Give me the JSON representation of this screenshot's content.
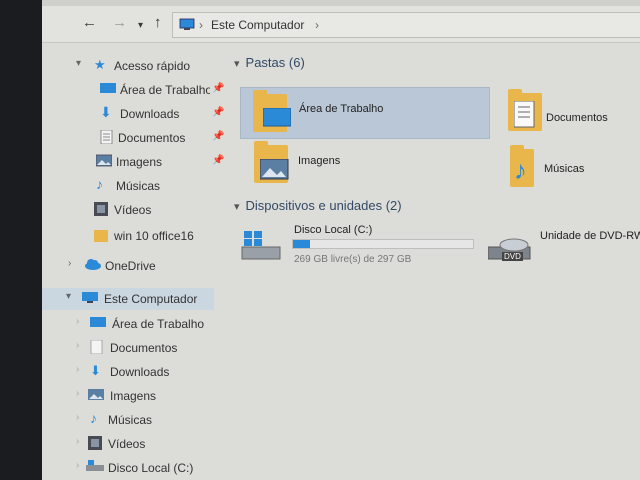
{
  "address": {
    "location": "Este Computador",
    "chevron": "›"
  },
  "sidebar": {
    "quick_access": "Acesso rápido",
    "quick_items": [
      {
        "label": "Área de Trabalho",
        "icon": "desktop-icon",
        "pinned": true
      },
      {
        "label": "Downloads",
        "icon": "download-icon",
        "pinned": true
      },
      {
        "label": "Documentos",
        "icon": "documents-icon",
        "pinned": true
      },
      {
        "label": "Imagens",
        "icon": "pictures-icon",
        "pinned": true
      },
      {
        "label": "Músicas",
        "icon": "music-icon",
        "pinned": false
      },
      {
        "label": "Vídeos",
        "icon": "videos-icon",
        "pinned": false
      },
      {
        "label": "win 10 office16",
        "icon": "folder-icon",
        "pinned": false
      }
    ],
    "onedrive": "OneDrive",
    "this_pc": "Este Computador",
    "pc_items": [
      {
        "label": "Área de Trabalho",
        "icon": "desktop-icon"
      },
      {
        "label": "Documentos",
        "icon": "documents-icon"
      },
      {
        "label": "Downloads",
        "icon": "download-icon"
      },
      {
        "label": "Imagens",
        "icon": "pictures-icon"
      },
      {
        "label": "Músicas",
        "icon": "music-icon"
      },
      {
        "label": "Vídeos",
        "icon": "videos-icon"
      },
      {
        "label": "Disco Local (C:)",
        "icon": "drive-icon"
      }
    ]
  },
  "main": {
    "folders_header": "Pastas (6)",
    "folders": [
      {
        "label": "Área de Trabalho",
        "icon": "desktop-folder-icon",
        "selected": true
      },
      {
        "label": "Documentos",
        "icon": "documents-folder-icon",
        "selected": false
      },
      {
        "label": "Imagens",
        "icon": "pictures-folder-icon",
        "selected": false
      },
      {
        "label": "Músicas",
        "icon": "music-folder-icon",
        "selected": false
      }
    ],
    "devices_header": "Dispositivos e unidades (2)",
    "drive": {
      "label": "Disco Local (C:)",
      "space": "269 GB livre(s) de 297 GB",
      "used_fraction": 0.094
    },
    "dvd": {
      "label": "Unidade de DVD-RW",
      "badge": "DVD"
    }
  },
  "colors": {
    "accent": "#2b8ad8",
    "selection": "#b9c7d6",
    "folder": "#e8b64a"
  }
}
